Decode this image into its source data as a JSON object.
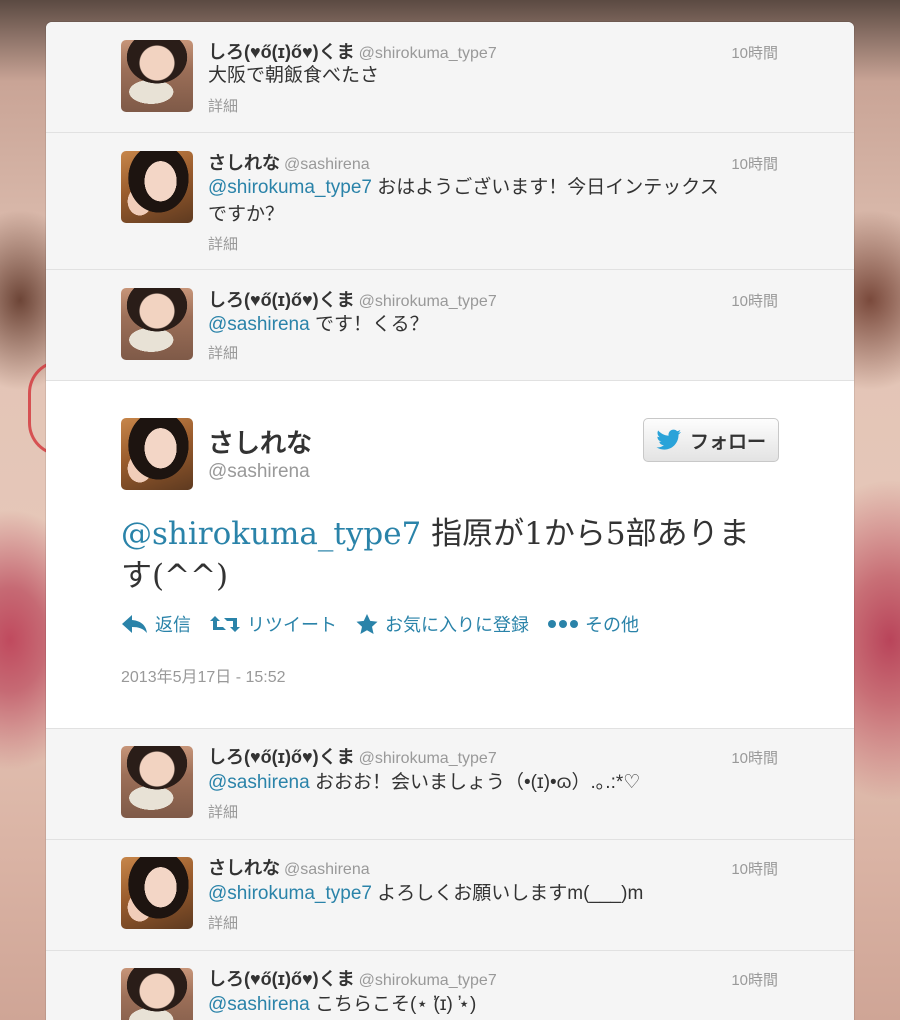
{
  "colors": {
    "link": "#2a83a9",
    "muted": "#999999",
    "text": "#333333"
  },
  "tweets_before": [
    {
      "avatar": "shiro",
      "name": "しろ(♥ő(ɪ)ő♥)くま",
      "handle": "@shirokuma_type7",
      "time": "10時間",
      "mention": "",
      "text": "大阪で朝飯食べたさ",
      "details": "詳細"
    },
    {
      "avatar": "sashi",
      "name": "さしれな",
      "handle": "@sashirena",
      "time": "10時間",
      "mention": "@shirokuma_type7",
      "text": " おはようございます！今日インテックスですか？",
      "details": "詳細"
    },
    {
      "avatar": "shiro",
      "name": "しろ(♥ő(ɪ)ő♥)くま",
      "handle": "@shirokuma_type7",
      "time": "10時間",
      "mention": "@sashirena",
      "text": " です！くる？",
      "details": "詳細"
    }
  ],
  "expanded": {
    "name": "さしれな",
    "handle": "@sashirena",
    "follow_label": "フォロー",
    "mention": "@shirokuma_type7",
    "text": " 指原が1から5部あります(^^)",
    "actions": {
      "reply": "返信",
      "retweet": "リツイート",
      "favorite": "お気に入りに登録",
      "more": "その他"
    },
    "timestamp": "2013年5月17日 - 15:52"
  },
  "tweets_after": [
    {
      "avatar": "shiro",
      "name": "しろ(♥ő(ɪ)ő♥)くま",
      "handle": "@shirokuma_type7",
      "time": "10時間",
      "mention": "@sashirena",
      "text": " おおお！会いましょう（•(ɪ)•ɷ）.｡.:*♡",
      "details": "詳細"
    },
    {
      "avatar": "sashi",
      "name": "さしれな",
      "handle": "@sashirena",
      "time": "10時間",
      "mention": "@shirokuma_type7",
      "text": " よろしくお願いしますm(___)m",
      "details": "詳細"
    },
    {
      "avatar": "shiro",
      "name": "しろ(♥ő(ɪ)ő♥)くま",
      "handle": "@shirokuma_type7",
      "time": "10時間",
      "mention": "@sashirena",
      "text": " こちらこそ(⋆ ̛(ɪ) ̛⋆)",
      "details": ""
    }
  ]
}
